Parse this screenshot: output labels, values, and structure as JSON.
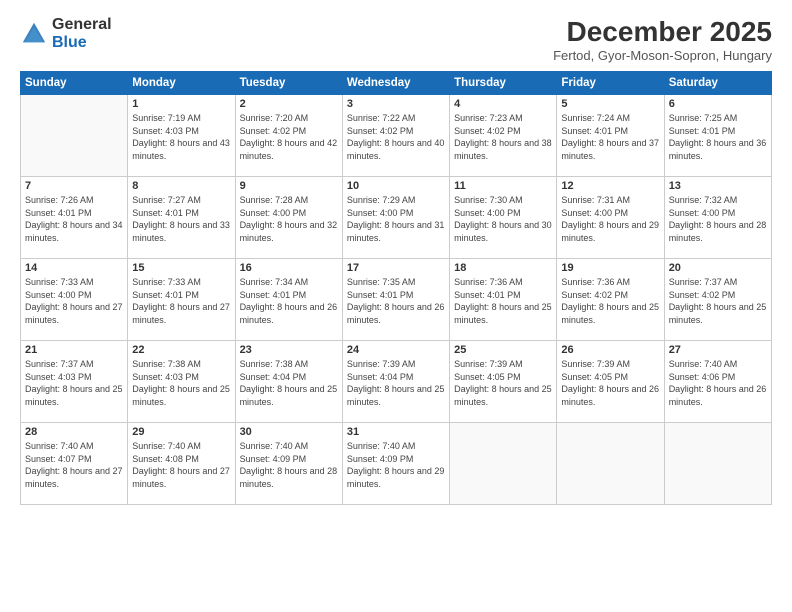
{
  "logo": {
    "general": "General",
    "blue": "Blue"
  },
  "title": "December 2025",
  "subtitle": "Fertod, Gyor-Moson-Sopron, Hungary",
  "headers": [
    "Sunday",
    "Monday",
    "Tuesday",
    "Wednesday",
    "Thursday",
    "Friday",
    "Saturday"
  ],
  "weeks": [
    [
      {
        "day": "",
        "sunrise": "",
        "sunset": "",
        "daylight": ""
      },
      {
        "day": "1",
        "sunrise": "Sunrise: 7:19 AM",
        "sunset": "Sunset: 4:03 PM",
        "daylight": "Daylight: 8 hours and 43 minutes."
      },
      {
        "day": "2",
        "sunrise": "Sunrise: 7:20 AM",
        "sunset": "Sunset: 4:02 PM",
        "daylight": "Daylight: 8 hours and 42 minutes."
      },
      {
        "day": "3",
        "sunrise": "Sunrise: 7:22 AM",
        "sunset": "Sunset: 4:02 PM",
        "daylight": "Daylight: 8 hours and 40 minutes."
      },
      {
        "day": "4",
        "sunrise": "Sunrise: 7:23 AM",
        "sunset": "Sunset: 4:02 PM",
        "daylight": "Daylight: 8 hours and 38 minutes."
      },
      {
        "day": "5",
        "sunrise": "Sunrise: 7:24 AM",
        "sunset": "Sunset: 4:01 PM",
        "daylight": "Daylight: 8 hours and 37 minutes."
      },
      {
        "day": "6",
        "sunrise": "Sunrise: 7:25 AM",
        "sunset": "Sunset: 4:01 PM",
        "daylight": "Daylight: 8 hours and 36 minutes."
      }
    ],
    [
      {
        "day": "7",
        "sunrise": "Sunrise: 7:26 AM",
        "sunset": "Sunset: 4:01 PM",
        "daylight": "Daylight: 8 hours and 34 minutes."
      },
      {
        "day": "8",
        "sunrise": "Sunrise: 7:27 AM",
        "sunset": "Sunset: 4:01 PM",
        "daylight": "Daylight: 8 hours and 33 minutes."
      },
      {
        "day": "9",
        "sunrise": "Sunrise: 7:28 AM",
        "sunset": "Sunset: 4:00 PM",
        "daylight": "Daylight: 8 hours and 32 minutes."
      },
      {
        "day": "10",
        "sunrise": "Sunrise: 7:29 AM",
        "sunset": "Sunset: 4:00 PM",
        "daylight": "Daylight: 8 hours and 31 minutes."
      },
      {
        "day": "11",
        "sunrise": "Sunrise: 7:30 AM",
        "sunset": "Sunset: 4:00 PM",
        "daylight": "Daylight: 8 hours and 30 minutes."
      },
      {
        "day": "12",
        "sunrise": "Sunrise: 7:31 AM",
        "sunset": "Sunset: 4:00 PM",
        "daylight": "Daylight: 8 hours and 29 minutes."
      },
      {
        "day": "13",
        "sunrise": "Sunrise: 7:32 AM",
        "sunset": "Sunset: 4:00 PM",
        "daylight": "Daylight: 8 hours and 28 minutes."
      }
    ],
    [
      {
        "day": "14",
        "sunrise": "Sunrise: 7:33 AM",
        "sunset": "Sunset: 4:00 PM",
        "daylight": "Daylight: 8 hours and 27 minutes."
      },
      {
        "day": "15",
        "sunrise": "Sunrise: 7:33 AM",
        "sunset": "Sunset: 4:01 PM",
        "daylight": "Daylight: 8 hours and 27 minutes."
      },
      {
        "day": "16",
        "sunrise": "Sunrise: 7:34 AM",
        "sunset": "Sunset: 4:01 PM",
        "daylight": "Daylight: 8 hours and 26 minutes."
      },
      {
        "day": "17",
        "sunrise": "Sunrise: 7:35 AM",
        "sunset": "Sunset: 4:01 PM",
        "daylight": "Daylight: 8 hours and 26 minutes."
      },
      {
        "day": "18",
        "sunrise": "Sunrise: 7:36 AM",
        "sunset": "Sunset: 4:01 PM",
        "daylight": "Daylight: 8 hours and 25 minutes."
      },
      {
        "day": "19",
        "sunrise": "Sunrise: 7:36 AM",
        "sunset": "Sunset: 4:02 PM",
        "daylight": "Daylight: 8 hours and 25 minutes."
      },
      {
        "day": "20",
        "sunrise": "Sunrise: 7:37 AM",
        "sunset": "Sunset: 4:02 PM",
        "daylight": "Daylight: 8 hours and 25 minutes."
      }
    ],
    [
      {
        "day": "21",
        "sunrise": "Sunrise: 7:37 AM",
        "sunset": "Sunset: 4:03 PM",
        "daylight": "Daylight: 8 hours and 25 minutes."
      },
      {
        "day": "22",
        "sunrise": "Sunrise: 7:38 AM",
        "sunset": "Sunset: 4:03 PM",
        "daylight": "Daylight: 8 hours and 25 minutes."
      },
      {
        "day": "23",
        "sunrise": "Sunrise: 7:38 AM",
        "sunset": "Sunset: 4:04 PM",
        "daylight": "Daylight: 8 hours and 25 minutes."
      },
      {
        "day": "24",
        "sunrise": "Sunrise: 7:39 AM",
        "sunset": "Sunset: 4:04 PM",
        "daylight": "Daylight: 8 hours and 25 minutes."
      },
      {
        "day": "25",
        "sunrise": "Sunrise: 7:39 AM",
        "sunset": "Sunset: 4:05 PM",
        "daylight": "Daylight: 8 hours and 25 minutes."
      },
      {
        "day": "26",
        "sunrise": "Sunrise: 7:39 AM",
        "sunset": "Sunset: 4:05 PM",
        "daylight": "Daylight: 8 hours and 26 minutes."
      },
      {
        "day": "27",
        "sunrise": "Sunrise: 7:40 AM",
        "sunset": "Sunset: 4:06 PM",
        "daylight": "Daylight: 8 hours and 26 minutes."
      }
    ],
    [
      {
        "day": "28",
        "sunrise": "Sunrise: 7:40 AM",
        "sunset": "Sunset: 4:07 PM",
        "daylight": "Daylight: 8 hours and 27 minutes."
      },
      {
        "day": "29",
        "sunrise": "Sunrise: 7:40 AM",
        "sunset": "Sunset: 4:08 PM",
        "daylight": "Daylight: 8 hours and 27 minutes."
      },
      {
        "day": "30",
        "sunrise": "Sunrise: 7:40 AM",
        "sunset": "Sunset: 4:09 PM",
        "daylight": "Daylight: 8 hours and 28 minutes."
      },
      {
        "day": "31",
        "sunrise": "Sunrise: 7:40 AM",
        "sunset": "Sunset: 4:09 PM",
        "daylight": "Daylight: 8 hours and 29 minutes."
      },
      {
        "day": "",
        "sunrise": "",
        "sunset": "",
        "daylight": ""
      },
      {
        "day": "",
        "sunrise": "",
        "sunset": "",
        "daylight": ""
      },
      {
        "day": "",
        "sunrise": "",
        "sunset": "",
        "daylight": ""
      }
    ]
  ]
}
